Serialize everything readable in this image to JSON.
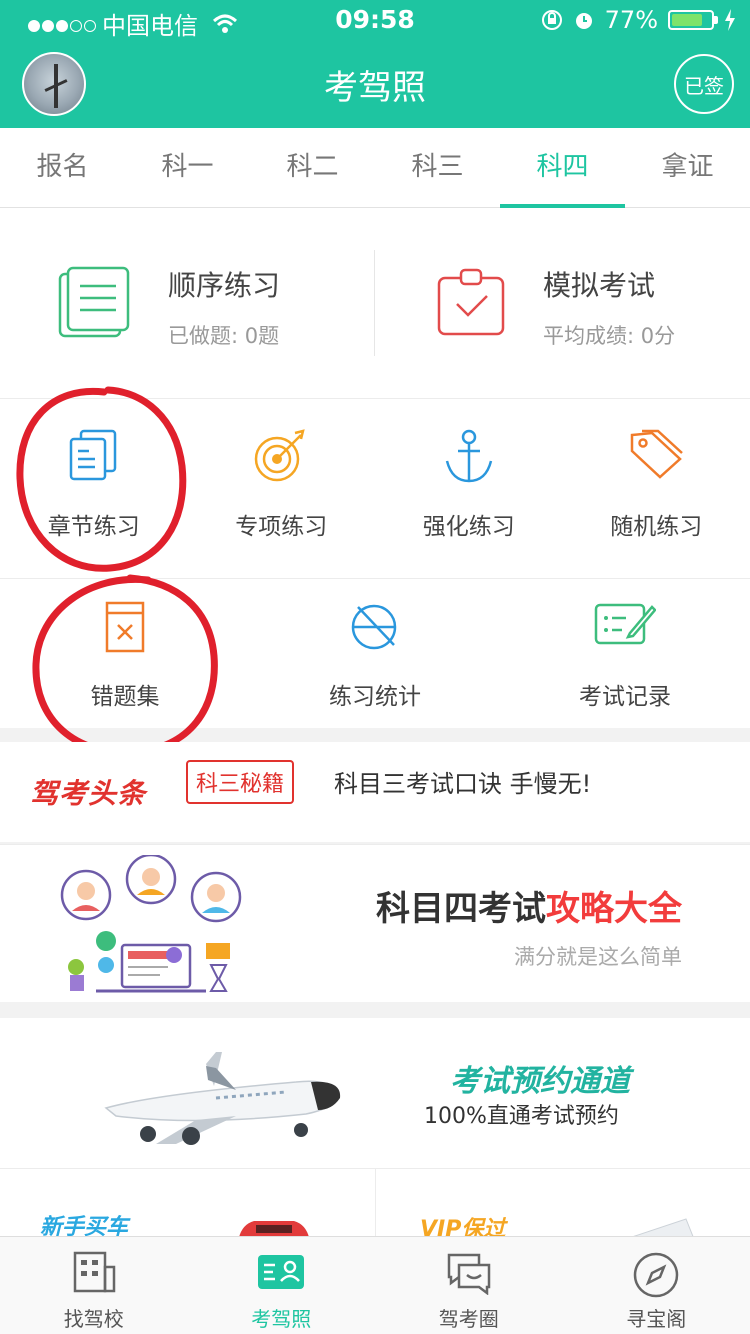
{
  "status_bar": {
    "carrier": "中国电信",
    "time": "09:58",
    "battery": "77%",
    "signal_bars_filled": 3,
    "signal_bars_total": 5
  },
  "header": {
    "title": "考驾照",
    "sign_label": "已签",
    "accent_color": "#1ec5a1"
  },
  "tabs": [
    {
      "label": "报名"
    },
    {
      "label": "科一"
    },
    {
      "label": "科二"
    },
    {
      "label": "科三"
    },
    {
      "label": "科四",
      "active": true
    },
    {
      "label": "拿证"
    }
  ],
  "practice_cards": [
    {
      "title": "顺序练习",
      "subtitle": "已做题: 0题",
      "icon": "notebook-icon"
    },
    {
      "title": "模拟考试",
      "subtitle": "平均成绩: 0分",
      "icon": "clipboard-check-icon"
    }
  ],
  "grid_row1": [
    {
      "label": "章节练习",
      "icon": "document-stack-icon"
    },
    {
      "label": "专项练习",
      "icon": "target-icon"
    },
    {
      "label": "强化练习",
      "icon": "anchor-icon"
    },
    {
      "label": "随机练习",
      "icon": "tag-icon"
    }
  ],
  "grid_row2": [
    {
      "label": "错题集",
      "icon": "error-book-icon"
    },
    {
      "label": "练习统计",
      "icon": "stats-icon"
    },
    {
      "label": "考试记录",
      "icon": "record-edit-icon"
    }
  ],
  "news": {
    "logo": "驾考头条",
    "tag": "科三秘籍",
    "headline": "科目三考试口诀 手慢无!"
  },
  "banner_strategy": {
    "title_prefix": "科目四考试",
    "title_highlight": "攻略大全",
    "subtitle": "满分就是这么简单"
  },
  "banner_booking": {
    "title": "考试预约通道",
    "subtitle": "100%直通考试预约"
  },
  "banner_bottom": {
    "left": "新手买车",
    "right": "VIP保过"
  },
  "bottom_nav": [
    {
      "label": "找驾校",
      "icon": "building-icon"
    },
    {
      "label": "考驾照",
      "icon": "id-card-icon",
      "active": true
    },
    {
      "label": "驾考圈",
      "icon": "chat-bubbles-icon"
    },
    {
      "label": "寻宝阁",
      "icon": "compass-icon"
    }
  ]
}
